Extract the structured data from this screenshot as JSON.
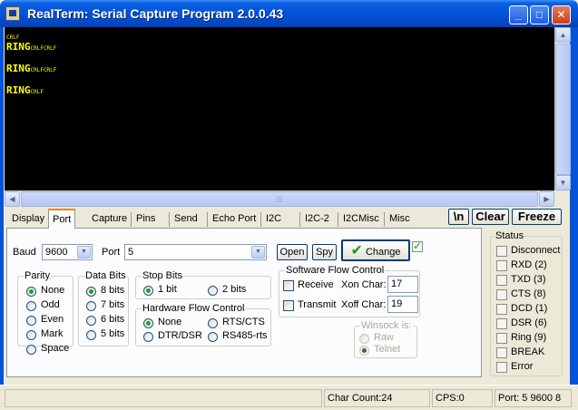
{
  "window": {
    "title": "RealTerm: Serial Capture Program 2.0.0.43",
    "minimize": "_",
    "maximize": "□",
    "close": "✕"
  },
  "terminal": {
    "lines": [
      {
        "text": "",
        "ctl": "CRLF"
      },
      {
        "text": "RING",
        "ctl": "CRLFCRLF"
      },
      {
        "text": "RING",
        "ctl": "CRLFCRLF"
      },
      {
        "text": "RING",
        "ctl": "CRLF"
      }
    ],
    "text_color": "#ffff00",
    "background": "#000000"
  },
  "scroll": {
    "up": "▲",
    "down": "▼",
    "left": "◀",
    "right": "▶",
    "grip": "|||"
  },
  "tabs": [
    "Display",
    "Port",
    "Capture",
    "Pins",
    "Send",
    "Echo Port",
    "I2C",
    "I2C-2",
    "I2CMisc",
    "Misc"
  ],
  "active_tab": "Port",
  "toolbar": {
    "newline": "\\n",
    "clear": "Clear",
    "freeze": "Freeze"
  },
  "port": {
    "baud_label": "Baud",
    "baud_value": "9600",
    "port_label": "Port",
    "port_value": "5",
    "open": "Open",
    "spy": "Spy",
    "change": "Change",
    "change_icon": "✔",
    "parity": {
      "title": "Parity",
      "options": [
        "None",
        "Odd",
        "Even",
        "Mark",
        "Space"
      ],
      "selected": "None"
    },
    "data_bits": {
      "title": "Data Bits",
      "options": [
        "8 bits",
        "7 bits",
        "6 bits",
        "5 bits"
      ],
      "selected": "8 bits"
    },
    "stop_bits": {
      "title": "Stop Bits",
      "options": [
        "1 bit",
        "2 bits"
      ],
      "selected": "1 bit"
    },
    "hw_flow": {
      "title": "Hardware Flow Control",
      "options": [
        "None",
        "RTS/CTS",
        "DTR/DSR",
        "RS485-rts"
      ],
      "selected": "None"
    },
    "sw_flow": {
      "title": "Software Flow Control",
      "receive": "Receive",
      "transmit": "Transmit",
      "xon_label": "Xon Char:",
      "xon_value": "17",
      "xoff_label": "Xoff Char:",
      "xoff_value": "19"
    },
    "winsock": {
      "title": "Winsock is:",
      "options": [
        "Raw",
        "Telnet"
      ],
      "selected": "Telnet"
    }
  },
  "status_panel": {
    "title": "Status",
    "items": [
      "Disconnect",
      "RXD (2)",
      "TXD (3)",
      "CTS (8)",
      "DCD (1)",
      "DSR (6)",
      "Ring (9)",
      "BREAK",
      "Error"
    ]
  },
  "statusbar": {
    "char_count": "Char Count:24",
    "cps": "CPS:0",
    "port": "Port: 5 9600 8"
  }
}
